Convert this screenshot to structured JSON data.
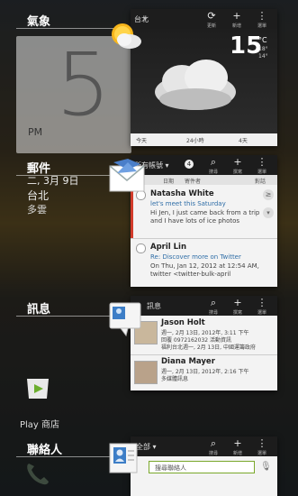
{
  "categories": {
    "weather": "氣象",
    "mail": "郵件",
    "messages": "訊息",
    "contacts": "聯絡人"
  },
  "clock": {
    "hour": "5",
    "ampm": "PM",
    "date": "二, 3月 9日",
    "city": "台北",
    "condition": "多雲"
  },
  "weather_panel": {
    "location_label": "台北",
    "temperature": "15",
    "unit": "°C",
    "hi": "18°",
    "lo": "14°",
    "btn_update": "更新",
    "btn_add": "新增",
    "btn_menu": "選單",
    "tabs": [
      "今天",
      "24小時",
      "4天"
    ]
  },
  "mail_panel": {
    "title": "所有帳號",
    "count": "4",
    "btn_search": "搜尋",
    "btn_compose": "撰寫",
    "btn_menu": "選單",
    "subtabs": [
      "日期",
      "寄件者",
      "對話"
    ],
    "items": [
      {
        "from": "Natasha White",
        "subject": "let's meet this Saturday",
        "preview": "Hi Jen, I just came back from a trip and I have lots of ice photos"
      },
      {
        "from": "April Lin",
        "subject": "Re: Discover more on Twitter",
        "preview": "On Thu, Jan 12, 2012 at 12:54 AM, twitter <twitter-bulk-april"
      }
    ]
  },
  "messages_panel": {
    "title": "訊息",
    "btn_search": "搜尋",
    "btn_compose": "撰寫",
    "btn_menu": "選單",
    "items": [
      {
        "name": "Jason Holt",
        "line1": "週一, 2月 13日, 2012年, 3:11 下午",
        "line2": "回覆 0972162032 活動資訊",
        "line3": "福利台北週一, 2月 13日, 中國運籌政府"
      },
      {
        "name": "Diana Mayer",
        "line1": "週一, 2月 13日, 2012年, 2:16 下午",
        "line2": "多媒體訊息"
      }
    ]
  },
  "contacts_panel": {
    "title": "全部",
    "btn_search": "搜尋",
    "btn_add": "新增",
    "btn_menu": "選單",
    "search_placeholder": "搜尋聯絡人"
  },
  "app_label": "Play 商店",
  "colors": {
    "accent_green": "#7aa82b",
    "unread_red": "#d23b2b"
  }
}
